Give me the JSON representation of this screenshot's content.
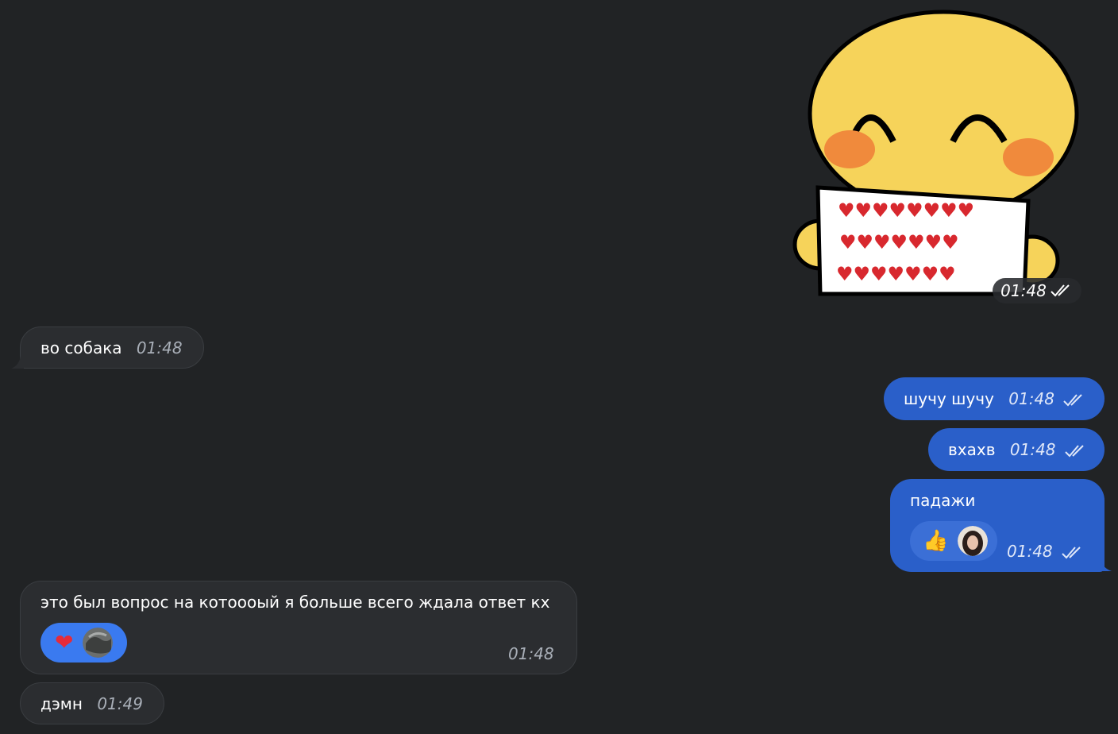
{
  "messages": {
    "sticker": {
      "time": "01:48",
      "status_icon": "double-check-icon"
    },
    "m1": {
      "text": "во собака",
      "time": "01:48"
    },
    "m2": {
      "text": "шучу шучу",
      "time": "01:48"
    },
    "m3": {
      "text": "вхахв",
      "time": "01:48"
    },
    "m4": {
      "text": "падажи",
      "time": "01:48",
      "reaction": {
        "emoji": "👍",
        "icon": "thumbs-up-icon"
      }
    },
    "m5": {
      "text": "это был вопрос на котоооый я больше всего ждала ответ кх",
      "time": "01:48",
      "reaction": {
        "emoji": "❤",
        "icon": "heart-icon"
      }
    },
    "m6": {
      "text": "дэмн",
      "time": "01:49"
    }
  },
  "colors": {
    "background": "#212325",
    "incoming_bubble": "#2b2d30",
    "outgoing_bubble": "#2a5fc9",
    "reaction_active": "#3a7af0"
  }
}
